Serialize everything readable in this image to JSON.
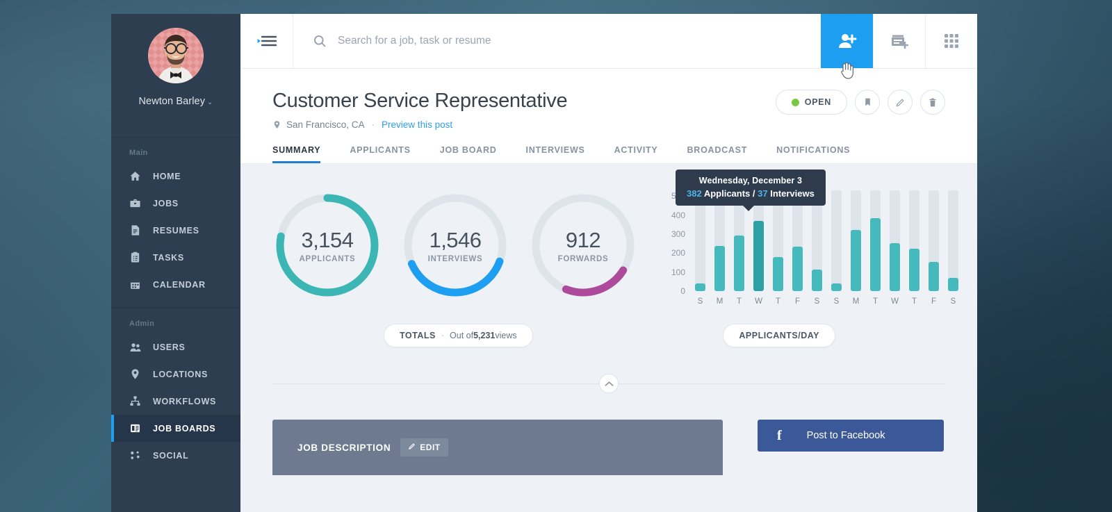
{
  "profile": {
    "name": "Newton Barley",
    "caret": "⌄"
  },
  "sidebar": {
    "sections": [
      {
        "label": "Main",
        "items": [
          {
            "label": "HOME",
            "icon": "home-icon"
          },
          {
            "label": "JOBS",
            "icon": "briefcase-icon"
          },
          {
            "label": "RESUMES",
            "icon": "document-icon"
          },
          {
            "label": "TASKS",
            "icon": "clipboard-icon"
          },
          {
            "label": "CALENDAR",
            "icon": "calendar-icon"
          }
        ]
      },
      {
        "label": "Admin",
        "items": [
          {
            "label": "USERS",
            "icon": "users-icon"
          },
          {
            "label": "LOCATIONS",
            "icon": "map-pin-icon"
          },
          {
            "label": "WORKFLOWS",
            "icon": "sitemap-icon"
          },
          {
            "label": "JOB BOARDS",
            "icon": "board-icon",
            "active": true
          },
          {
            "label": "SOCIAL",
            "icon": "share-icon"
          }
        ]
      }
    ]
  },
  "topbar": {
    "menu_icon": "hamburger-collapse-icon",
    "search": {
      "placeholder": "Search for a job, task or resume",
      "value": "",
      "icon": "search-icon"
    },
    "actions": [
      {
        "name": "add-person-icon",
        "active": true
      },
      {
        "name": "add-event-icon",
        "active": false
      },
      {
        "name": "apps-grid-icon",
        "active": false
      }
    ]
  },
  "header": {
    "title": "Customer Service Representative",
    "location": "San Francisco, CA",
    "separator": "·",
    "preview_link": "Preview this post",
    "status_label": "OPEN",
    "status_color": "#7ac943",
    "actions": [
      {
        "name": "bookmark-button"
      },
      {
        "name": "edit-button"
      },
      {
        "name": "delete-button"
      }
    ]
  },
  "tabs": [
    {
      "label": "SUMMARY",
      "active": true
    },
    {
      "label": "APPLICANTS",
      "active": false
    },
    {
      "label": "JOB BOARD",
      "active": false
    },
    {
      "label": "INTERVIEWS",
      "active": false
    },
    {
      "label": "ACTIVITY",
      "active": false
    },
    {
      "label": "BROADCAST",
      "active": false
    },
    {
      "label": "NOTIFICATIONS",
      "active": false
    }
  ],
  "chart_data": [
    {
      "type": "pie",
      "title": "APPLICANTS",
      "value": 3154,
      "value_label": "3,154",
      "percent": 78,
      "color": "#3cb5b5",
      "track_color": "#dde4ea"
    },
    {
      "type": "pie",
      "title": "INTERVIEWS",
      "value": 1546,
      "value_label": "1,546",
      "percent": 38,
      "color": "#1e9ef0",
      "track_color": "#dde4ea"
    },
    {
      "type": "pie",
      "title": "FORWARDS",
      "value": 912,
      "value_label": "912",
      "percent": 22,
      "color": "#ad4a9c",
      "track_color": "#dde4ea"
    },
    {
      "type": "bar",
      "title": "APPLICANTS/DAY",
      "categories": [
        "S",
        "M",
        "T",
        "W",
        "T",
        "F",
        "S",
        "S",
        "M",
        "T",
        "W",
        "T",
        "F",
        "S"
      ],
      "values": [
        40,
        237,
        293,
        370,
        178,
        233,
        115,
        42,
        323,
        383,
        252,
        222,
        152,
        68
      ],
      "highlight_index": 3,
      "ylim": [
        0,
        530
      ],
      "yticks": [
        0,
        100,
        200,
        300,
        400,
        500
      ],
      "ytick_labels": [
        "0",
        "100",
        "200",
        "300",
        "400",
        "500"
      ],
      "xlabel": "",
      "ylabel": "",
      "grid": false,
      "bar_color": "#46b9bd",
      "highlight_color": "#2f9fa6",
      "track_color": "#dde4ea"
    }
  ],
  "tooltip": {
    "title": "Wednesday, December 3",
    "applicants_num": "382",
    "applicants_word": " Applicants ",
    "divider": "/ ",
    "interviews_num": "37",
    "interviews_word": " Interviews"
  },
  "pills": {
    "totals_label": "TOTALS",
    "totals_mid": "·",
    "totals_text_a": "Out of ",
    "totals_number": "5,231",
    "totals_text_b": " views",
    "applicants_per_day": "APPLICANTS/DAY"
  },
  "collapse": {
    "icon": "chevron-up-icon"
  },
  "bottom": {
    "job_description_title": "JOB DESCRIPTION",
    "edit_label": "EDIT",
    "edit_icon": "pencil-icon",
    "facebook_icon": "facebook-icon",
    "facebook_label": "Post to Facebook"
  }
}
